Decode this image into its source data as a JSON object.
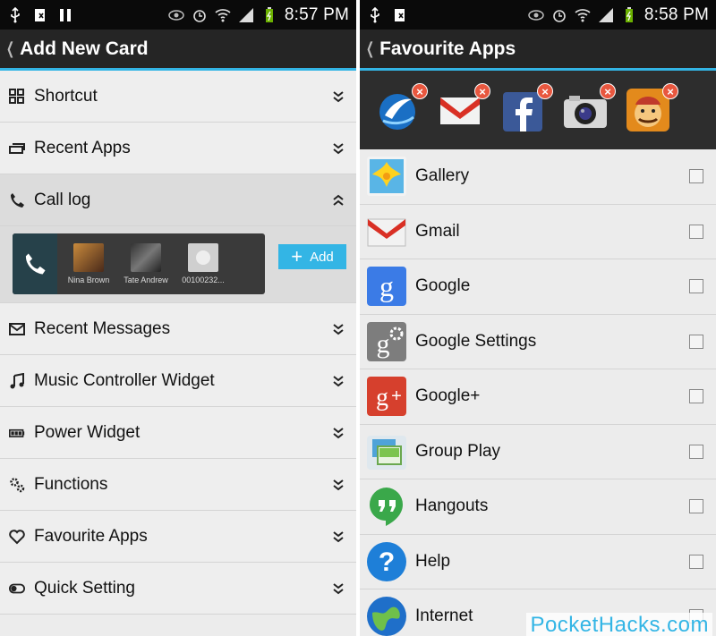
{
  "left": {
    "status": {
      "time": "8:57 PM"
    },
    "title": "Add New Card",
    "cards": [
      {
        "label": "Shortcut",
        "icon": "grid-icon",
        "state": "collapsed"
      },
      {
        "label": "Recent Apps",
        "icon": "recent-apps-icon",
        "state": "collapsed"
      },
      {
        "label": "Call log",
        "icon": "phone-icon",
        "state": "expanded"
      },
      {
        "label": "Recent Messages",
        "icon": "envelope-icon",
        "state": "collapsed"
      },
      {
        "label": "Music Controller Widget",
        "icon": "music-note-icon",
        "state": "collapsed"
      },
      {
        "label": "Power Widget",
        "icon": "battery-icon",
        "state": "collapsed"
      },
      {
        "label": "Functions",
        "icon": "gears-icon",
        "state": "collapsed"
      },
      {
        "label": "Favourite Apps",
        "icon": "heart-icon",
        "state": "collapsed"
      },
      {
        "label": "Quick Setting",
        "icon": "toggle-icon",
        "state": "collapsed"
      }
    ],
    "calllog": {
      "contacts": [
        "Nina Brown",
        "Tate Andrew",
        "00100232..."
      ],
      "add_label": "Add"
    }
  },
  "right": {
    "status": {
      "time": "8:58 PM"
    },
    "title": "Favourite Apps",
    "favourites": [
      "browser-icon",
      "gmail-icon",
      "facebook-icon",
      "camera-icon",
      "clash-of-clans-icon"
    ],
    "apps": [
      {
        "label": "Gallery",
        "icon": "gallery-icon"
      },
      {
        "label": "Gmail",
        "icon": "gmail-icon"
      },
      {
        "label": "Google",
        "icon": "google-icon"
      },
      {
        "label": "Google Settings",
        "icon": "google-settings-icon"
      },
      {
        "label": "Google+",
        "icon": "google-plus-icon"
      },
      {
        "label": "Group Play",
        "icon": "group-play-icon"
      },
      {
        "label": "Hangouts",
        "icon": "hangouts-icon"
      },
      {
        "label": "Help",
        "icon": "help-icon"
      },
      {
        "label": "Internet",
        "icon": "internet-icon"
      }
    ]
  },
  "watermark": "PocketHacks.com",
  "colors": {
    "accent": "#33b5e5",
    "actionbar": "#252525",
    "statusbar": "#0a0a0a",
    "list_bg": "#eeeeee"
  }
}
